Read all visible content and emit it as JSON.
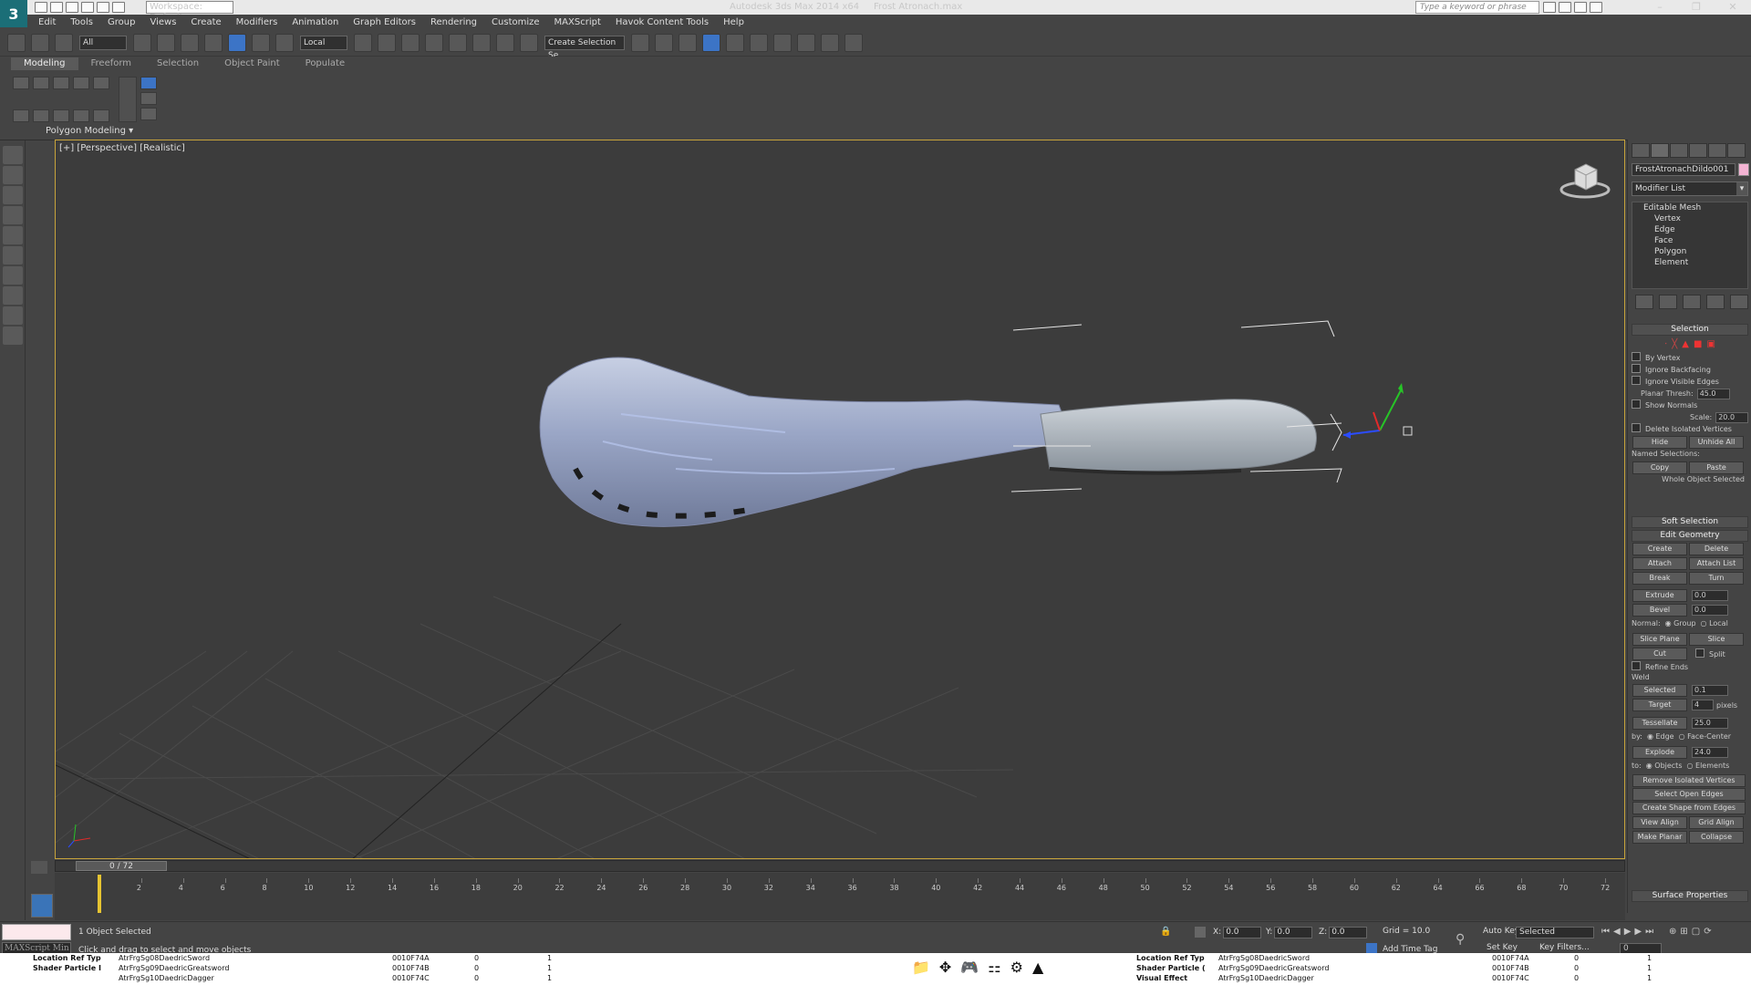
{
  "window": {
    "app_title": "Autodesk 3ds Max  2014 x64",
    "file_title": "Frost Atronach.max",
    "workspace": "Workspace: Default",
    "search_placeholder": "Type a keyword or phrase"
  },
  "menu": [
    "Edit",
    "Tools",
    "Group",
    "Views",
    "Create",
    "Modifiers",
    "Animation",
    "Graph Editors",
    "Rendering",
    "Customize",
    "MAXScript",
    "Havok Content Tools",
    "Help"
  ],
  "toolbar": {
    "selection_filter": "All",
    "ref_coord": "Local",
    "named_selection": "Create Selection Se"
  },
  "ribbon": {
    "tabs": [
      "Modeling",
      "Freeform",
      "Selection",
      "Object Paint",
      "Populate"
    ],
    "active_tab": "Modeling",
    "panel_label": "Polygon Modeling"
  },
  "viewport": {
    "label": "[+] [Perspective] [Realistic]"
  },
  "command_panel": {
    "object_name": "FrostAtronachDildo001",
    "object_color": "#f4b4d4",
    "modifier_list": "Modifier List",
    "stack": {
      "top": "Editable Mesh",
      "subs": [
        "Vertex",
        "Edge",
        "Face",
        "Polygon",
        "Element"
      ]
    },
    "selection": {
      "title": "Selection",
      "by_vertex": "By Vertex",
      "ignore_backfacing": "Ignore Backfacing",
      "ignore_visible_edges": "Ignore Visible Edges",
      "planar_thresh": "Planar Thresh:",
      "planar_value": "45.0",
      "show_normals": "Show Normals",
      "scale_label": "Scale:",
      "scale_value": "20.0",
      "delete_isolated": "Delete Isolated Vertices",
      "hide": "Hide",
      "unhide_all": "Unhide All",
      "named_selections": "Named Selections:",
      "copy": "Copy",
      "paste": "Paste",
      "whole_object": "Whole Object Selected"
    },
    "soft_selection": "Soft Selection",
    "edit_geometry": {
      "title": "Edit Geometry",
      "create": "Create",
      "delete": "Delete",
      "attach": "Attach",
      "attach_list": "Attach List",
      "break": "Break",
      "turn": "Turn",
      "extrude": "Extrude",
      "extrude_value": "0.0",
      "bevel": "Bevel",
      "bevel_value": "0.0",
      "normal": "Normal:",
      "group": "Group",
      "local": "Local",
      "slice_plane": "Slice Plane",
      "slice": "Slice",
      "cut": "Cut",
      "split": "Split",
      "refine_ends": "Refine Ends",
      "weld": "Weld",
      "selected": "Selected",
      "selected_value": "0.1",
      "target": "Target",
      "target_value": "4",
      "pixels": "pixels",
      "tessellate": "Tessellate",
      "tessellate_value": "25.0",
      "by": "by:",
      "edge": "Edge",
      "face_center": "Face-Center",
      "explode": "Explode",
      "explode_value": "24.0",
      "to": "to:",
      "objects": "Objects",
      "elements": "Elements",
      "remove_isolated": "Remove Isolated Vertices",
      "select_open_edges": "Select Open Edges",
      "create_shape": "Create Shape from Edges",
      "view_align": "View Align",
      "grid_align": "Grid Align",
      "make_planar": "Make Planar",
      "collapse": "Collapse"
    },
    "surface_properties": "Surface Properties"
  },
  "timeline": {
    "frame_display": "0 / 72",
    "ticks": [
      "2",
      "4",
      "6",
      "8",
      "10",
      "12",
      "14",
      "16",
      "18",
      "20",
      "22",
      "24",
      "26",
      "28",
      "30",
      "32",
      "34",
      "36",
      "38",
      "40",
      "42",
      "44",
      "46",
      "48",
      "50",
      "52",
      "54",
      "56",
      "58",
      "60",
      "62",
      "64",
      "66",
      "68",
      "70",
      "72"
    ]
  },
  "status": {
    "maxscript_label": "MAXScript Min",
    "objects_selected": "1 Object Selected",
    "prompt": "Click and drag to select and move objects",
    "x_label": "X:",
    "x_value": "0.0",
    "y_label": "Y:",
    "y_value": "0.0",
    "z_label": "Z:",
    "z_value": "0.0",
    "grid": "Grid = 10.0",
    "auto_key": "Auto Key",
    "key_mode": "Selected",
    "set_key": "Set Key",
    "key_filters": "Key Filters...",
    "add_time_tag": "Add Time Tag",
    "current_frame": "0"
  },
  "bottom_left": {
    "label1": "Location Ref Typ",
    "label2": "Shader Particle I",
    "rows": [
      {
        "name": "AtrFrgSg08DaedricSword",
        "id": "0010F74A",
        "a": "0",
        "b": "1"
      },
      {
        "name": "AtrFrgSg09DaedricGreatsword",
        "id": "0010F74B",
        "a": "0",
        "b": "1"
      },
      {
        "name": "AtrFrgSg10DaedricDagger",
        "id": "0010F74C",
        "a": "0",
        "b": "1"
      }
    ]
  },
  "bottom_right": {
    "label1": "Location Ref Typ",
    "label2": "Shader Particle (",
    "label3": "Visual Effect",
    "rows": [
      {
        "name": "AtrFrgSg08DaedricSword",
        "id": "0010F74A",
        "a": "0",
        "b": "1"
      },
      {
        "name": "AtrFrgSg09DaedricGreatsword",
        "id": "0010F74B",
        "a": "0",
        "b": "1"
      },
      {
        "name": "AtrFrgSg10DaedricDagger",
        "id": "0010F74C",
        "a": "0",
        "b": "1"
      }
    ]
  },
  "colors": {
    "viewport_border": "#c8a43c",
    "active_button": "#3c74c6",
    "app_logo": "#1b6e77"
  }
}
